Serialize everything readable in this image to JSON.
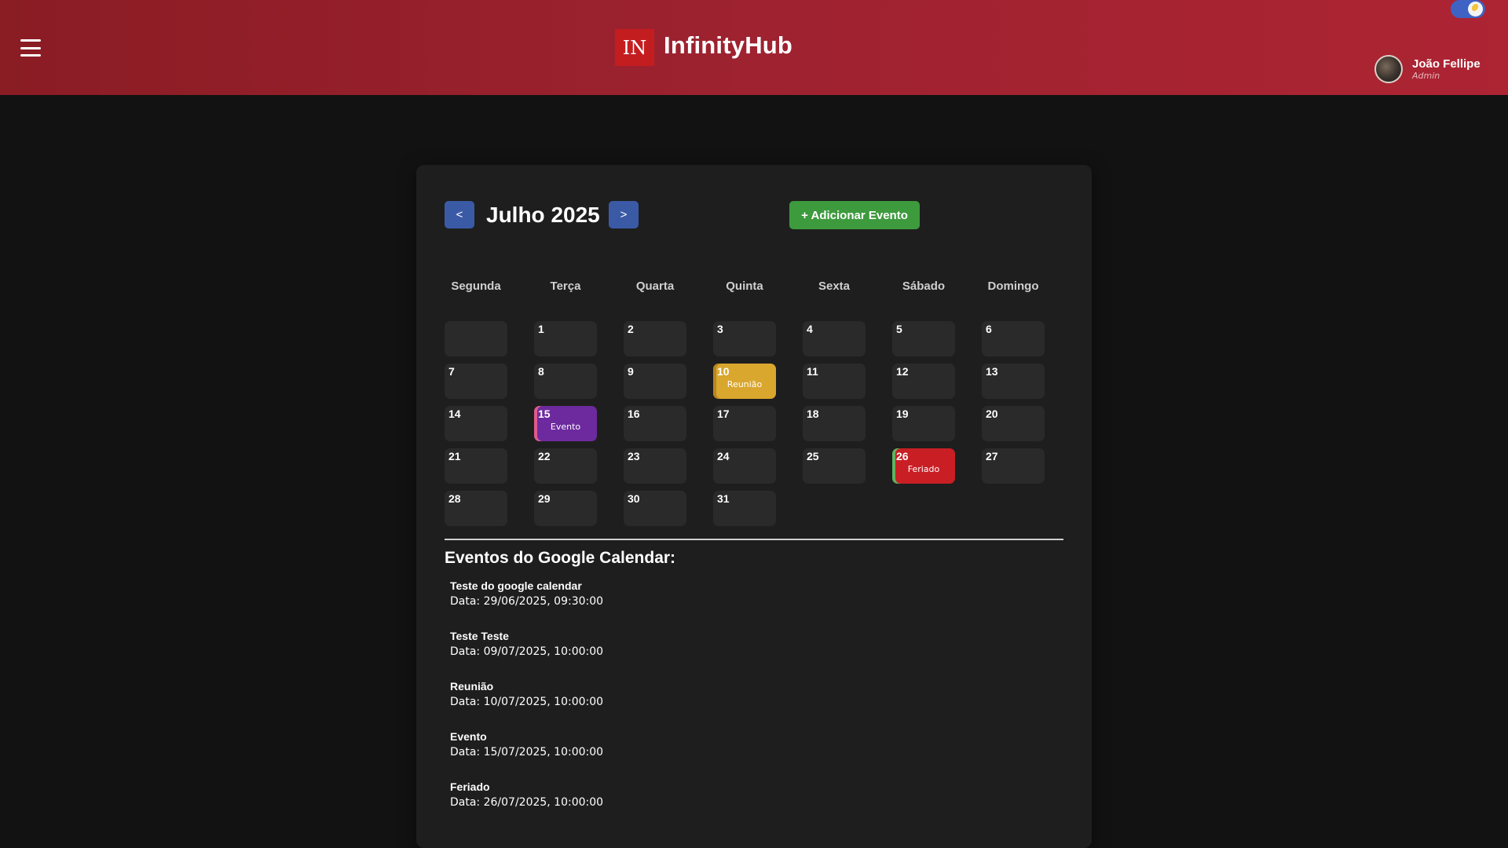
{
  "header": {
    "logo_text": "IN",
    "app_title": "InfinityHub",
    "user": {
      "name": "João Fellipe",
      "role": "Admin"
    }
  },
  "calendar": {
    "prev_label": "<",
    "next_label": ">",
    "month_title": "Julho 2025",
    "add_event_label": "+ Adicionar Evento",
    "weekdays": [
      "Segunda",
      "Terça",
      "Quarta",
      "Quinta",
      "Sexta",
      "Sábado",
      "Domingo"
    ],
    "days": [
      {
        "n": ""
      },
      {
        "n": "1"
      },
      {
        "n": "2"
      },
      {
        "n": "3"
      },
      {
        "n": "4"
      },
      {
        "n": "5"
      },
      {
        "n": "6"
      },
      {
        "n": "7"
      },
      {
        "n": "8"
      },
      {
        "n": "9"
      },
      {
        "n": "10",
        "event": "Reunião",
        "color": "#d9a62e",
        "accent": "#b8861f"
      },
      {
        "n": "11"
      },
      {
        "n": "12"
      },
      {
        "n": "13"
      },
      {
        "n": "14"
      },
      {
        "n": "15",
        "event": "Evento",
        "color": "#6d2a9e",
        "accent": "#e05a8a"
      },
      {
        "n": "16"
      },
      {
        "n": "17"
      },
      {
        "n": "18"
      },
      {
        "n": "19"
      },
      {
        "n": "20"
      },
      {
        "n": "21"
      },
      {
        "n": "22"
      },
      {
        "n": "23"
      },
      {
        "n": "24"
      },
      {
        "n": "25"
      },
      {
        "n": "26",
        "event": "Feriado",
        "color": "#c81e24",
        "accent": "#5fb35f"
      },
      {
        "n": "27"
      },
      {
        "n": "28"
      },
      {
        "n": "29"
      },
      {
        "n": "30"
      },
      {
        "n": "31"
      }
    ]
  },
  "google_events": {
    "title": "Eventos do Google Calendar:",
    "items": [
      {
        "name": "Teste do google calendar",
        "date": "Data: 29/06/2025, 09:30:00"
      },
      {
        "name": "Teste Teste",
        "date": "Data: 09/07/2025, 10:00:00"
      },
      {
        "name": "Reunião",
        "date": "Data: 10/07/2025, 10:00:00"
      },
      {
        "name": "Evento",
        "date": "Data: 15/07/2025, 10:00:00"
      },
      {
        "name": "Feriado",
        "date": "Data: 26/07/2025, 10:00:00"
      }
    ]
  },
  "colors": {
    "header_gradient_start": "#8a1c24",
    "header_gradient_end": "#ad2433",
    "nav_button": "#3b5aa6",
    "add_button": "#3d9a3d",
    "background": "#121212",
    "card": "#1e1e1e",
    "day_cell": "#2a2a2a"
  },
  "icons": [
    "menu-icon",
    "moon-icon"
  ]
}
